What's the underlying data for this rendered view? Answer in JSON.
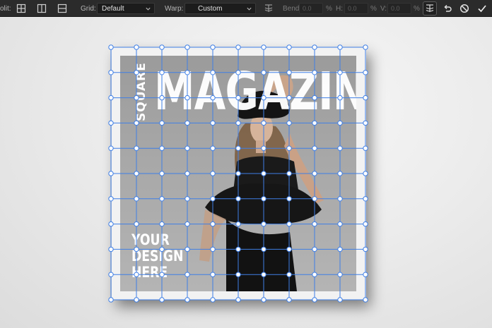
{
  "toolbar": {
    "split_label": "olit:",
    "grid_label": "Grid:",
    "grid_value": "Default",
    "warp_label": "Warp:",
    "warp_value": "Custom",
    "bend_label": "Bend:",
    "bend_value": "0.0",
    "h_label": "H:",
    "h_value": "0.0",
    "v_label": "V:",
    "v_value": "0.0",
    "percent": "%",
    "icons": {
      "split_cross": "split-cross-icon",
      "split_vertical": "split-vertical-icon",
      "split_horizontal": "split-horizontal-icon",
      "warp_orientation": "warp-orientation-icon",
      "warp_selection": "warp-selection-icon",
      "reset": "undo-icon",
      "cancel": "cancel-icon",
      "commit": "checkmark-icon"
    }
  },
  "document": {
    "masthead_side": "SQUARE",
    "masthead_title": "MAGAZINE",
    "tagline": [
      "YOUR",
      "DESIGN",
      "HERE"
    ]
  },
  "warp_grid": {
    "columns": 11,
    "rows": 11,
    "line_color": "#3f7fe6",
    "handle_fill": "#ffffff"
  },
  "colors": {
    "toolbar_bg": "#2b2b2b",
    "canvas_bg": "#e9e9e9",
    "accent": "#3f7fe6"
  }
}
